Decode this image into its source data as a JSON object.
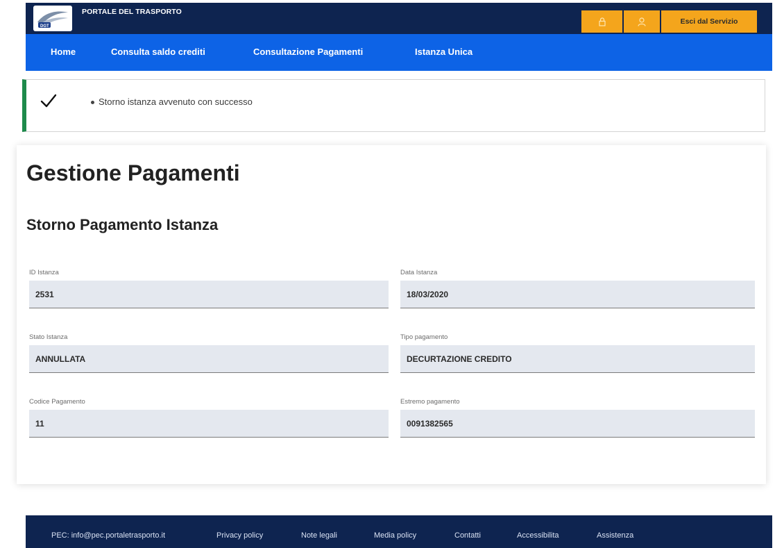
{
  "header": {
    "portal_title": "PORTALE DEL TRASPORTO",
    "logo_text": "DGT",
    "lock_icon": "lock-icon",
    "user_icon": "user-icon",
    "exit_label": "Esci dal Servizio",
    "accent_color": "#f4a51c",
    "bar_color": "#0e2450"
  },
  "nav": {
    "color": "#0d63e6",
    "items": [
      {
        "label": "Home"
      },
      {
        "label": "Consulta saldo crediti"
      },
      {
        "label": "Consultazione Pagamenti"
      },
      {
        "label": "Istanza Unica"
      }
    ]
  },
  "alert": {
    "icon": "check-icon",
    "message": "Storno istanza avvenuto con successo",
    "status_color": "#1d8a4b"
  },
  "main": {
    "title": "Gestione Pagamenti",
    "subtitle": "Storno Pagamento Istanza",
    "fields": [
      {
        "label": "ID Istanza",
        "value": "2531"
      },
      {
        "label": "Data Istanza",
        "value": "18/03/2020"
      },
      {
        "label": "Stato Istanza",
        "value": "ANNULLATA"
      },
      {
        "label": "Tipo pagamento",
        "value": "DECURTAZIONE CREDITO"
      },
      {
        "label": "Codice Pagamento",
        "value": "11"
      },
      {
        "label": "Estremo pagamento",
        "value": "0091382565"
      }
    ]
  },
  "footer": {
    "links": [
      {
        "label": "PEC: info@pec.portaletrasporto.it"
      },
      {
        "label": "Privacy policy"
      },
      {
        "label": "Note legali"
      },
      {
        "label": "Media policy"
      },
      {
        "label": "Contatti"
      },
      {
        "label": "Accessibilita"
      },
      {
        "label": "Assistenza"
      }
    ]
  }
}
